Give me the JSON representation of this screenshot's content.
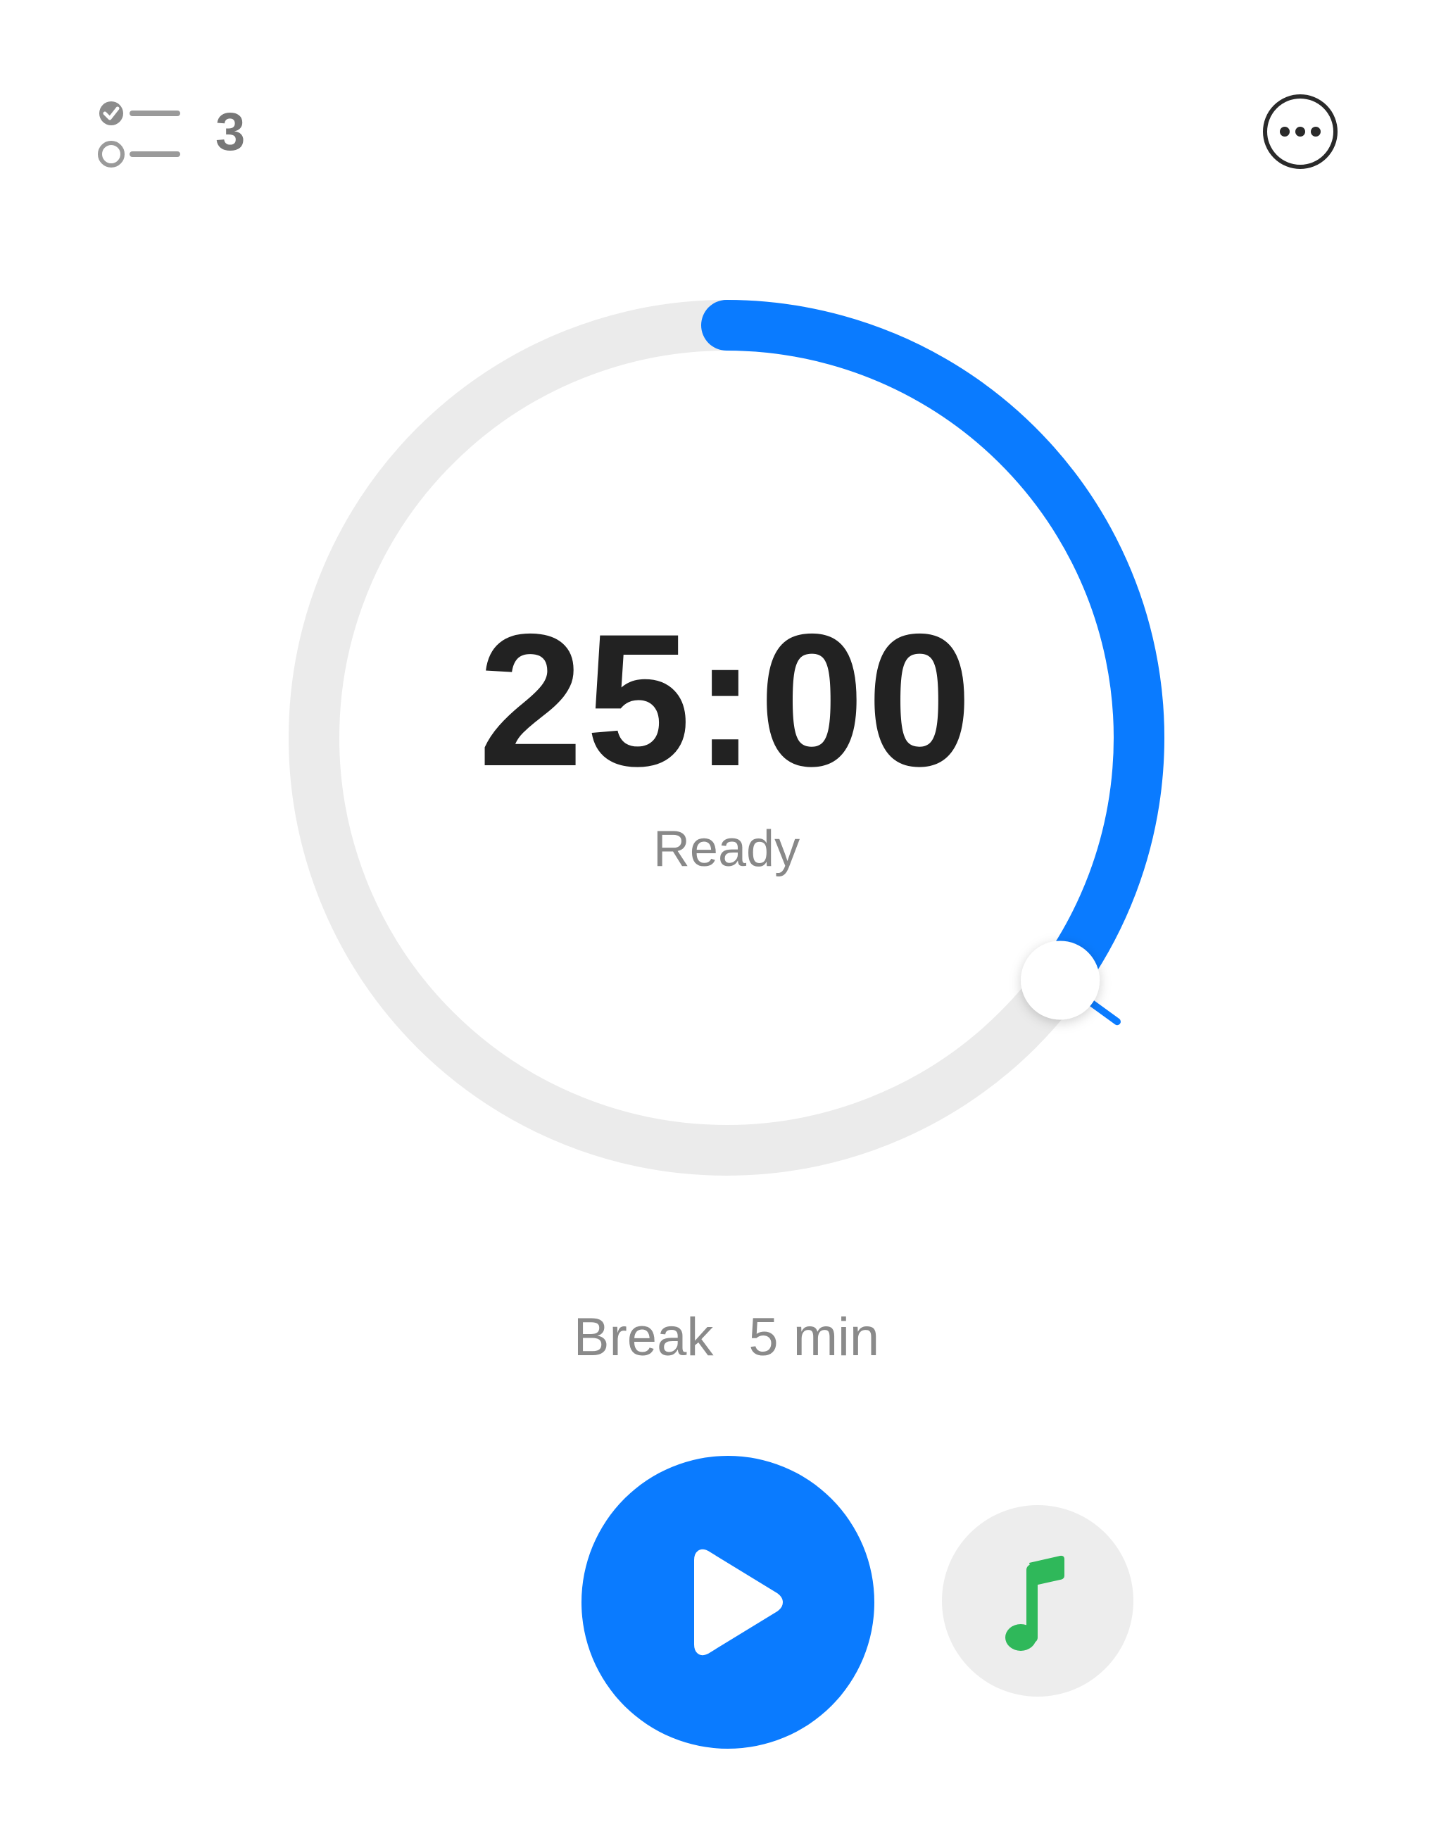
{
  "header": {
    "task_count": "3",
    "task_icon": "task-list-icon",
    "more_icon": "more-horizontal-icon"
  },
  "timer": {
    "time": "25:00",
    "status": "Ready",
    "progress_fraction": 0.35,
    "track_color": "#ebebeb",
    "progress_color": "#0a7bff"
  },
  "break": {
    "label": "Break",
    "value": "5 min"
  },
  "controls": {
    "play_icon": "play-icon",
    "play_color": "#0a7bff",
    "music_icon": "music-note-icon",
    "music_icon_color": "#2fb85a"
  }
}
